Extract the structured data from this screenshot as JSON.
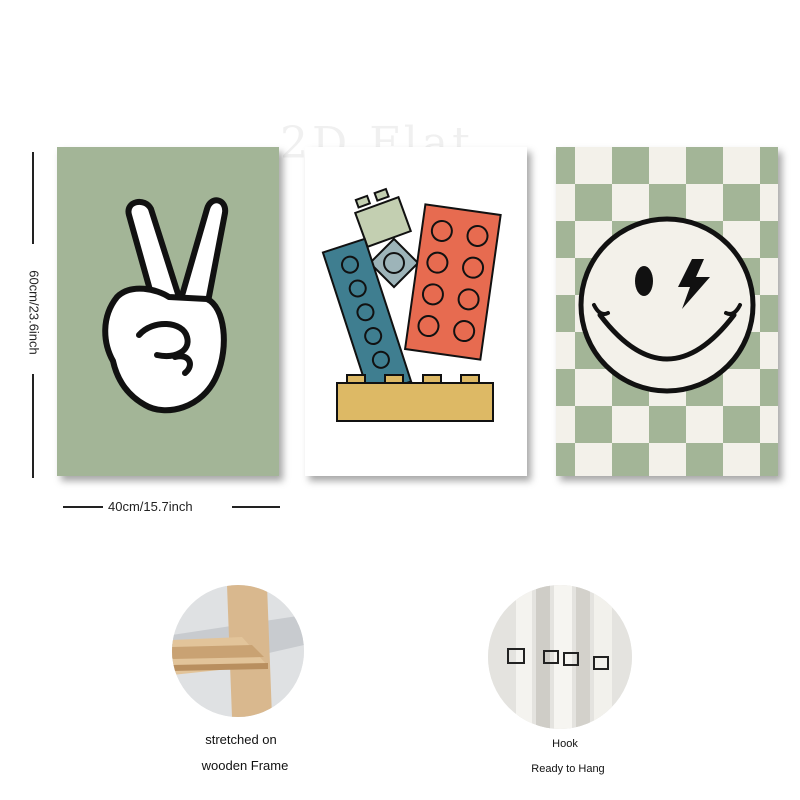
{
  "watermark": "2D Flat",
  "dimensions": {
    "height_label": "60cm/23.6inch",
    "width_label": "40cm/15.7inch"
  },
  "colors": {
    "sage": "#a3b597",
    "cream": "#f3f1ea",
    "teal": "#3f7e90",
    "coral": "#e76b50",
    "mustard": "#ddb965",
    "slate": "#9db4b9",
    "light_sage": "#c3cfb1",
    "ink": "#111111"
  },
  "posters": [
    {
      "name": "peace-hand",
      "icon": "peace-hand-icon"
    },
    {
      "name": "building-blocks",
      "icon": "toy-bricks-icon"
    },
    {
      "name": "smiley-checker",
      "icon": "lightning-smiley-icon"
    }
  ],
  "features": [
    {
      "icon": "wooden-frame-icon",
      "lines": [
        "stretched on",
        "wooden Frame"
      ]
    },
    {
      "icon": "hook-icon",
      "lines": [
        "Hook",
        "Ready to Hang"
      ]
    }
  ]
}
